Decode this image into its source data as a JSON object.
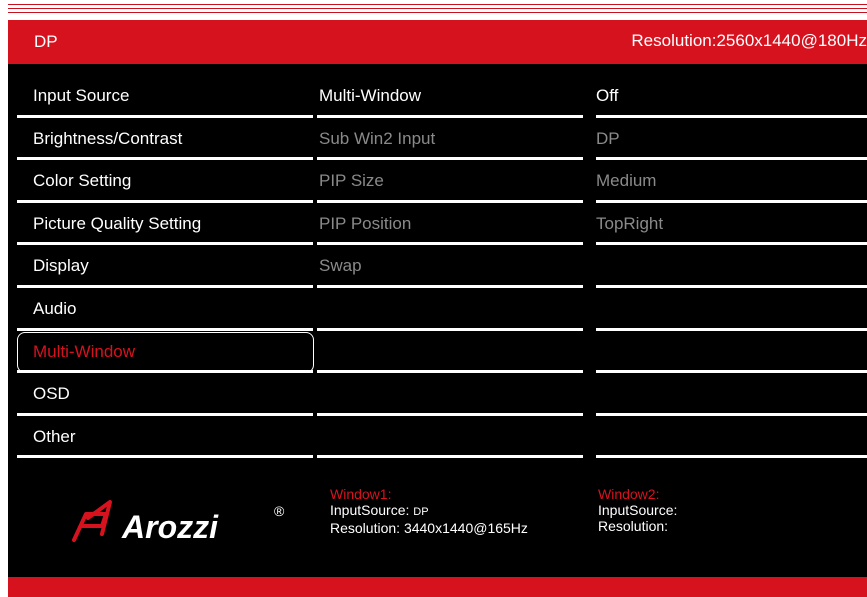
{
  "header": {
    "source": "DP",
    "resolution": "Resolution:2560x1440@180Hz"
  },
  "menu": [
    {
      "label": "Input Source"
    },
    {
      "label": "Brightness/Contrast"
    },
    {
      "label": "Color Setting"
    },
    {
      "label": "Picture Quality Setting"
    },
    {
      "label": "Display"
    },
    {
      "label": "Audio"
    },
    {
      "label": "Multi-Window",
      "selected": true
    },
    {
      "label": "OSD"
    },
    {
      "label": "Other"
    }
  ],
  "submenu": [
    {
      "label": "Multi-Window",
      "active": true
    },
    {
      "label": "Sub Win2 Input",
      "active": false
    },
    {
      "label": "PIP Size",
      "active": false
    },
    {
      "label": "PIP Position",
      "active": false
    },
    {
      "label": "Swap",
      "active": false
    }
  ],
  "values": [
    {
      "label": "Off",
      "active": true
    },
    {
      "label": "DP",
      "active": false
    },
    {
      "label": "Medium",
      "active": false
    },
    {
      "label": "TopRight",
      "active": false
    }
  ],
  "window1": {
    "title": "Window1:",
    "input_label": "InputSource:",
    "input_value": "DP",
    "resolution_label": "Resolution:",
    "resolution_value": "3440x1440@165Hz"
  },
  "window2": {
    "title": "Window2:",
    "input_label": "InputSource:",
    "resolution_label": "Resolution:"
  },
  "logo": {
    "text": "Arozzi",
    "mark": "®"
  },
  "colors": {
    "accent": "#d7121f",
    "background": "#000000",
    "dim_text": "#8a8a8a"
  },
  "icons": [
    "arozzi-logo-icon"
  ]
}
